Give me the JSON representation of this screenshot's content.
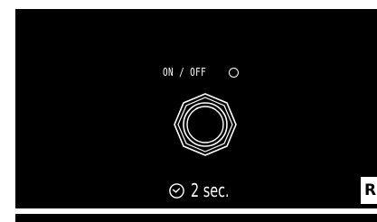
{
  "power": {
    "label": "ON / OFF"
  },
  "timer": {
    "text": "2 sec."
  },
  "side_tag": {
    "text": "R"
  },
  "icons": {
    "led": "led-indicator-icon",
    "switch": "footswitch-icon",
    "clock": "clock-icon"
  },
  "colors": {
    "panel": "#000000",
    "foreground": "#ffffff"
  }
}
